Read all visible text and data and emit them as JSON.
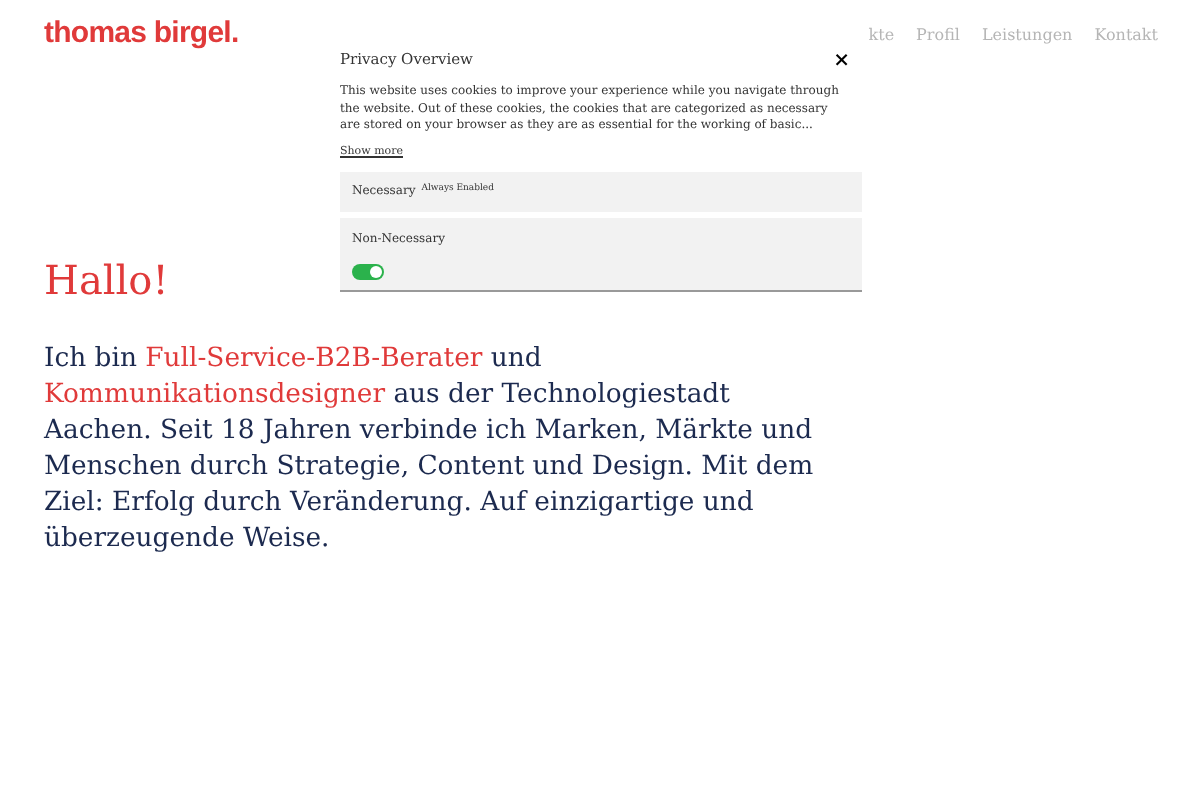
{
  "logo": "thomas birgel.",
  "nav": [
    "kte",
    "Profil",
    "Leistungen",
    "Kontakt"
  ],
  "privacy_dialog": {
    "title": "Privacy Overview",
    "close": "×",
    "text": "This website uses cookies to improve your experience while you navigate through the website. Out of these cookies, the cookies that are categorized as necessary are stored on your browser as they are as essential for the working of basic...",
    "show_more": "Show more",
    "categories": [
      {
        "name": "Necessary",
        "note": "Always Enabled",
        "kind": "fixed"
      },
      {
        "name": "Non-Necessary",
        "kind": "toggle",
        "on": true
      }
    ]
  },
  "heading": "Hallo!",
  "intro": [
    {
      "kind": "text",
      "text": "Ich bin "
    },
    {
      "kind": "link",
      "text": "Full-Service-B2B-Berater"
    },
    {
      "kind": "text",
      "text": " und "
    },
    {
      "kind": "link",
      "text": "Kommunikationsdesigner"
    },
    {
      "kind": "text",
      "text": " aus der Technologiestadt Aachen. Seit 18 Jahren verbinde ich Marken, Märkte und Menschen durch Strategie, Content und Design. Mit dem Ziel: Erfolg durch Veränderung. Auf einzigartige und überzeugende Weise."
    }
  ]
}
